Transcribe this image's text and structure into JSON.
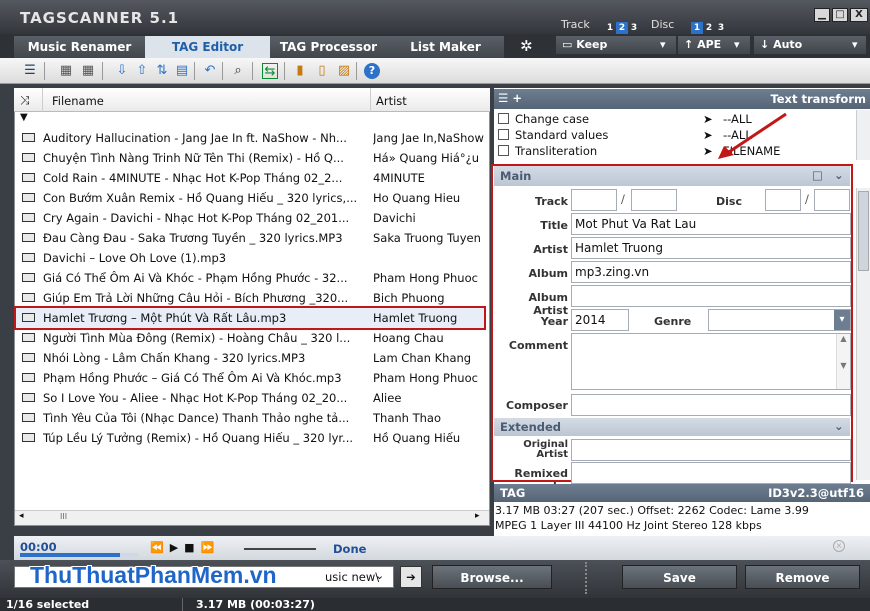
{
  "app": {
    "title": "TAGSCANNER 5.1"
  },
  "title_controls": {
    "track_label": "Track",
    "track_nums": [
      "1",
      "2",
      "3"
    ],
    "track_active": "2",
    "disc_label": "Disc",
    "disc_nums": [
      "1",
      "2",
      "3"
    ],
    "disc_active": "1",
    "keep_label": "Keep",
    "ape_label": "APE",
    "auto_label": "Auto",
    "min": "▁",
    "max": "□",
    "close": "X"
  },
  "tabs": [
    {
      "label": "Music Renamer",
      "active": false
    },
    {
      "label": "TAG Editor",
      "active": true
    },
    {
      "label": "TAG Processor",
      "active": false
    },
    {
      "label": "List Maker",
      "active": false
    }
  ],
  "file_list": {
    "columns": {
      "filename": "Filename",
      "artist": "Artist"
    },
    "rows": [
      {
        "filename": "Auditory Hallucination - Jang Jae In ft. NaShow - Nh...",
        "artist": "Jang Jae In,NaShow"
      },
      {
        "filename": "Chuyện Tình Nàng Trinh Nữ Tên Thi (Remix) - Hồ Q...",
        "artist": "Há» Quang Hiá°¿u"
      },
      {
        "filename": "Cold Rain - 4MINUTE - Nhạc Hot K-Pop Tháng 02_2...",
        "artist": "4MINUTE"
      },
      {
        "filename": "Con Bướm Xuân Remix - Hồ Quang Hiếu _ 320 lyrics,...",
        "artist": "Ho Quang Hieu"
      },
      {
        "filename": "Cry Again - Davichi - Nhạc Hot K-Pop Tháng 02_201...",
        "artist": "Davichi"
      },
      {
        "filename": "Đau Càng Đau - Saka Trương Tuyền _ 320 lyrics.MP3",
        "artist": "Saka Truong Tuyen"
      },
      {
        "filename": "Davichi – Love Oh Love (1).mp3",
        "artist": ""
      },
      {
        "filename": "Giá Có Thể Ôm Ai Và Khóc - Phạm Hồng Phước - 32...",
        "artist": "Pham Hong Phuoc"
      },
      {
        "filename": "Giúp Em Trả Lời Những Câu Hỏi - Bích Phương _320...",
        "artist": "Bich Phuong"
      },
      {
        "filename": "Hamlet Trương – Một Phút Và Rất Lâu.mp3",
        "artist": "Hamlet Truong",
        "selected": true
      },
      {
        "filename": "Người Tình Mùa Đông (Remix) - Hoàng Châu _ 320 l...",
        "artist": "Hoang Chau"
      },
      {
        "filename": "Nhói Lòng - Lâm Chấn Khang - 320 lyrics.MP3",
        "artist": "Lam Chan Khang"
      },
      {
        "filename": "Phạm Hồng Phước – Giá Có Thể Ôm Ai Và Khóc.mp3",
        "artist": "Pham Hong Phuoc"
      },
      {
        "filename": "So I Love You - Aliee - Nhạc Hot K-Pop Tháng 02_20...",
        "artist": "Aliee"
      },
      {
        "filename": "Tình Yêu Của Tôi (Nhạc Dance) Thanh Thảo nghe tả...",
        "artist": "Thanh Thao"
      },
      {
        "filename": "Túp Lều Lý Tưởng (Remix) - Hồ Quang Hiếu _ 320 lyr...",
        "artist": "Hồ Quang Hiếu"
      }
    ],
    "hscroll_grip": "III"
  },
  "text_transform": {
    "title": "Text transform",
    "rows": [
      {
        "label": "Change case",
        "target": "--ALL"
      },
      {
        "label": "Standard values",
        "target": "--ALL"
      },
      {
        "label": "Transliteration",
        "target": "FILENAME"
      }
    ]
  },
  "main": {
    "title": "Main",
    "labels": {
      "track": "Track",
      "disc": "Disc",
      "title": "Title",
      "artist": "Artist",
      "album": "Album",
      "album_artist": "Album Artist",
      "year": "Year",
      "genre": "Genre",
      "comment": "Comment",
      "composer": "Composer"
    },
    "values": {
      "track": "",
      "track_total": "",
      "disc": "",
      "disc_total": "",
      "title": "Mot Phut Va Rat Lau",
      "artist": "Hamlet Truong",
      "album": "mp3.zing.vn",
      "album_artist": "",
      "year": "2014",
      "genre": "",
      "comment": "",
      "composer": ""
    }
  },
  "extended": {
    "title": "Extended",
    "labels": {
      "original_artist": "Original Artist",
      "remixed_by": "Remixed by"
    },
    "values": {
      "original_artist": "",
      "remixed_by": ""
    }
  },
  "tag": {
    "label": "TAG",
    "version": "ID3v2.3@utf16",
    "info_line1": "3.17 MB 03:27 (207 sec.)  Offset: 2262  Codec: Lame 3.99",
    "info_line2": "MPEG 1 Layer III  44100 Hz  Joint Stereo  128 kbps"
  },
  "player": {
    "time": "00:00",
    "progress": 0.85,
    "status": "Done"
  },
  "bottom": {
    "logo_text": "ThuThuatPhanMem.vn",
    "path_tail": "usic new\\",
    "browse": "Browse...",
    "save": "Save",
    "remove": "Remove"
  },
  "status": {
    "selected": "1/16 selected",
    "size": "3.17 MB (00:03:27)"
  },
  "colors": {
    "accent": "#2c72c8",
    "highlight": "#c21717",
    "panel_header": "#566576"
  }
}
